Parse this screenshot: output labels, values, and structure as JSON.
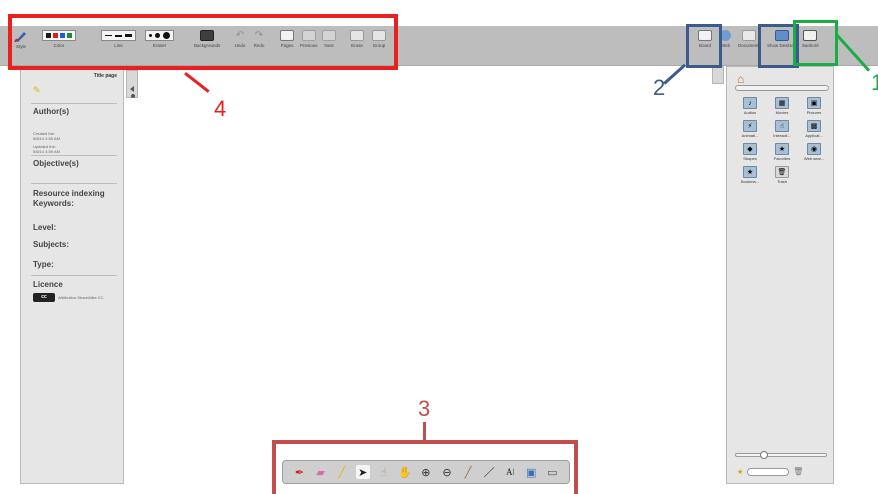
{
  "toolbar": {
    "groups": [
      {
        "id": "style",
        "label": "Style"
      },
      {
        "id": "color",
        "label": "Color"
      },
      {
        "id": "line",
        "label": "Line"
      },
      {
        "id": "eraser",
        "label": "Eraser"
      },
      {
        "id": "backgrounds",
        "label": "Backgrounds"
      },
      {
        "id": "undo",
        "label": "Undo"
      },
      {
        "id": "redo",
        "label": "Redo"
      },
      {
        "id": "pages",
        "label": "Pages"
      },
      {
        "id": "previous",
        "label": "Previous"
      },
      {
        "id": "next",
        "label": "Next"
      },
      {
        "id": "erase",
        "label": "Erase"
      },
      {
        "id": "group",
        "label": "Group"
      }
    ],
    "palette_colors": [
      "#1a1a1a",
      "#d62020",
      "#1e5bd6",
      "#1f8a32"
    ]
  },
  "right_toolbar": {
    "board": "Board",
    "web": "Web",
    "documents": "Documents",
    "show_desktop": "Show Desktop",
    "open_sankore": "Sankoré"
  },
  "left_panel": {
    "title_page": "Title page",
    "author_heading": "Author(s)",
    "created": "Created the:\n5/8/14 4:59 AM",
    "updated": "Updated the:\n5/8/14 4:59 AM",
    "objectives_heading": "Objective(s)",
    "resource_heading": "Resource indexing",
    "keywords": "Keywords:",
    "level": "Level:",
    "subjects": "Subjects:",
    "type": "Type:",
    "licence": "Licence",
    "licence_text": "Attribution-ShareAlike CC",
    "cc_badge": "cc"
  },
  "library": {
    "items": [
      {
        "label": "Audios",
        "icon": "♪"
      },
      {
        "label": "Movies",
        "icon": "▦"
      },
      {
        "label": "Pictures",
        "icon": "▣"
      },
      {
        "label": "Animati...",
        "icon": "⚡"
      },
      {
        "label": "Interacti...",
        "icon": "☝"
      },
      {
        "label": "Applicat...",
        "icon": "▩"
      },
      {
        "label": "Shapes",
        "icon": "◆"
      },
      {
        "label": "Favorites",
        "icon": "★"
      },
      {
        "label": "Web sear...",
        "icon": "◉"
      },
      {
        "label": "Bookma...",
        "icon": "★"
      },
      {
        "label": "Trash",
        "icon": "🗑"
      }
    ]
  },
  "annotations": {
    "label_1": "1",
    "label_2": "2",
    "label_3": "3",
    "label_4": "4"
  },
  "colors": {
    "red": "#ea1f1f",
    "blue": "#3a5b8c",
    "green": "#1aad46",
    "brown": "#c14d4d"
  }
}
